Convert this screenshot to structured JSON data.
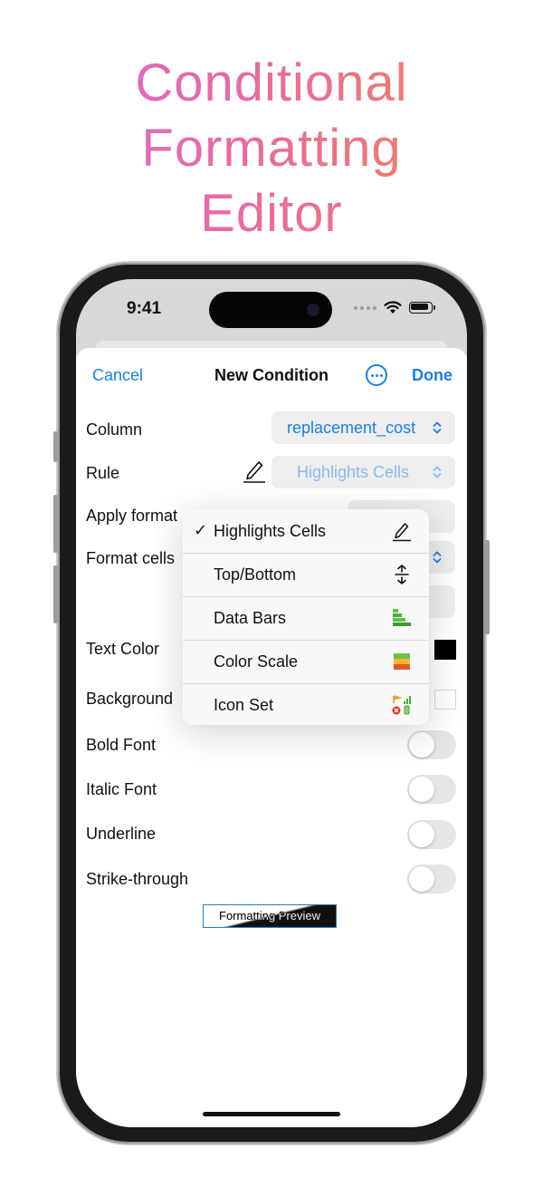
{
  "promo": {
    "title_lines": [
      "Conditional",
      "Formatting",
      "Editor"
    ]
  },
  "status_bar": {
    "time": "9:41",
    "icons": [
      "cellular-dots-icon",
      "wifi-icon",
      "battery-icon"
    ]
  },
  "nav": {
    "cancel_label": "Cancel",
    "title": "New Condition",
    "more_icon": "ellipsis-circle-icon",
    "done_label": "Done"
  },
  "form": {
    "column": {
      "label": "Column",
      "value": "replacement_cost"
    },
    "rule": {
      "label": "Rule",
      "value": "Highlights Cells",
      "edit_icon": "pencil-icon"
    },
    "apply_format": {
      "label": "Apply format"
    },
    "format_cells": {
      "label": "Format cells"
    },
    "text_color": {
      "label": "Text Color",
      "swatch": "#000000"
    },
    "background": {
      "label": "Background",
      "swatch": "#ffffff"
    },
    "bold_font": {
      "label": "Bold Font",
      "on": false
    },
    "italic_font": {
      "label": "Italic Font",
      "on": false
    },
    "underline": {
      "label": "Underline",
      "on": false
    },
    "strike_through": {
      "label": "Strike-through",
      "on": false
    }
  },
  "preview": {
    "text": "Formatting Preview"
  },
  "rule_menu": {
    "items": [
      {
        "label": "Highlights Cells",
        "checked": true,
        "icon": "pencil-icon"
      },
      {
        "label": "Top/Bottom",
        "checked": false,
        "icon": "arrow-up-down-icon"
      },
      {
        "label": "Data Bars",
        "checked": false,
        "icon": "data-bars-icon"
      },
      {
        "label": "Color Scale",
        "checked": false,
        "icon": "color-scale-icon"
      },
      {
        "label": "Icon Set",
        "checked": false,
        "icon": "icon-set-icon"
      }
    ],
    "check_glyph": "✓"
  },
  "colors": {
    "accent": "#1a80e6",
    "title_gradient_start": "#d86be0",
    "title_gradient_end": "#f5884c"
  }
}
